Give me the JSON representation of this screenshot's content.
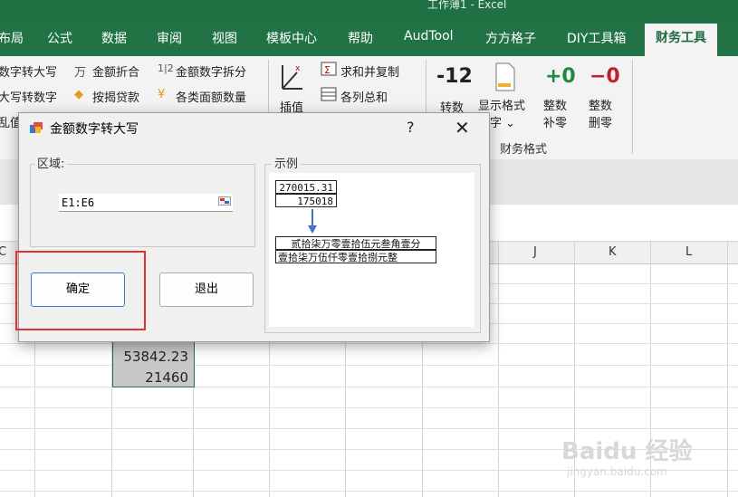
{
  "window": {
    "title": "工作薄1  -  Excel"
  },
  "tabs": [
    {
      "label": "布局",
      "active": false
    },
    {
      "label": "公式",
      "active": false
    },
    {
      "label": "数据",
      "active": false
    },
    {
      "label": "审阅",
      "active": false
    },
    {
      "label": "视图",
      "active": false
    },
    {
      "label": "模板中心",
      "active": false
    },
    {
      "label": "帮助",
      "active": false
    },
    {
      "label": "AudTool",
      "active": false
    },
    {
      "label": "方方格子",
      "active": false
    },
    {
      "label": "DIY工具箱",
      "active": false
    },
    {
      "label": "财务工具",
      "active": true
    }
  ],
  "ribbon": {
    "col1": [
      "数字转大写",
      "大写转数字",
      "乱值"
    ],
    "col2": [
      "金额折合",
      "按揭贷款"
    ],
    "col3": [
      "金额数字拆分",
      "各类面额数量"
    ],
    "col2_icons": [
      "万",
      "◆"
    ],
    "col3_icons": [
      "1|2",
      "¥"
    ],
    "insert_label": "插值",
    "col4": [
      "求和并复制",
      "各列总和"
    ],
    "fmt_buttons": [
      {
        "big": "-12",
        "label": "转数"
      },
      {
        "big": "",
        "label": "显示格式\n数字 ⌄"
      },
      {
        "big": "+0",
        "label": "整数\n补零"
      },
      {
        "big": "−0",
        "label": "整数\n删零"
      }
    ],
    "group_label": "财务格式"
  },
  "sheet": {
    "col_headers": [
      "C",
      "J",
      "K",
      "L"
    ],
    "cells": [
      "53842.23",
      "21460",
      "???"
    ]
  },
  "dialog": {
    "title": "金额数字转大写",
    "help": "?",
    "close": "✕",
    "range_legend": "区域:",
    "range_value": "E1:E6",
    "example_legend": "示例",
    "example": {
      "num1": "270015.31",
      "num2": "175018",
      "text1": "贰拾柒万零壹拾伍元叁角壹分",
      "text2": "壹拾柒万伍仟零壹拾捌元整"
    },
    "ok": "确定",
    "exit": "退出"
  },
  "watermark": {
    "main": "Baidu 经验",
    "sub": "jingyan.baidu.com"
  },
  "colors": {
    "excel_green": "#217346",
    "highlight_red": "#e03030",
    "arrow_blue": "#4472c4"
  }
}
